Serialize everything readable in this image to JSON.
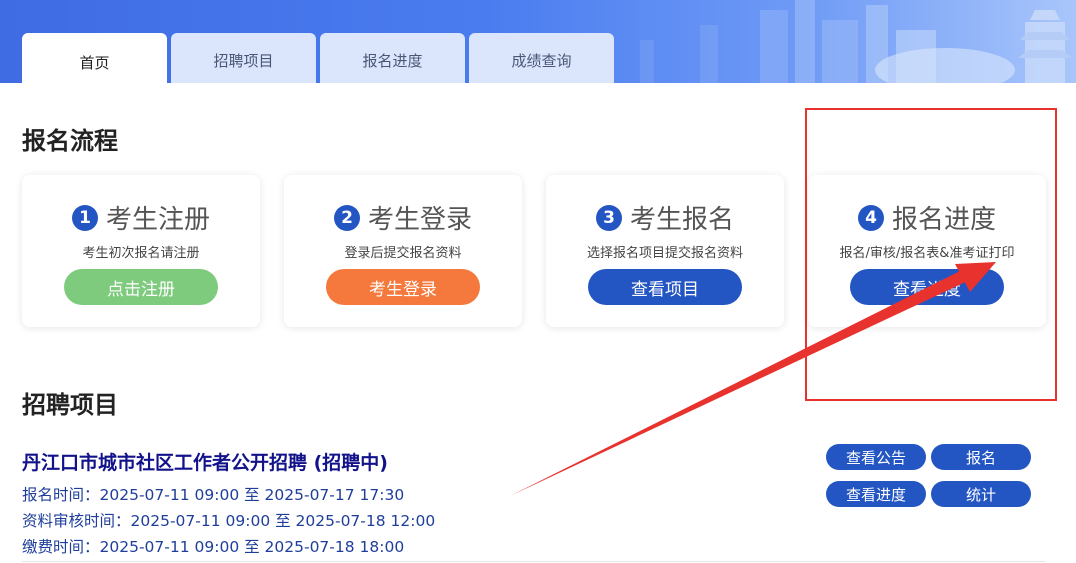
{
  "tabs": [
    {
      "label": "首页",
      "active": true
    },
    {
      "label": "招聘项目",
      "active": false
    },
    {
      "label": "报名进度",
      "active": false
    },
    {
      "label": "成绩查询",
      "active": false
    }
  ],
  "process": {
    "title": "报名流程",
    "steps": [
      {
        "num": "1",
        "title": "考生注册",
        "desc": "考生初次报名请注册",
        "button": "点击注册"
      },
      {
        "num": "2",
        "title": "考生登录",
        "desc": "登录后提交报名资料",
        "button": "考生登录"
      },
      {
        "num": "3",
        "title": "考生报名",
        "desc": "选择报名项目提交报名资料",
        "button": "查看项目"
      },
      {
        "num": "4",
        "title": "报名进度",
        "desc": "报名/审核/报名表&准考证打印",
        "button": "查看进度"
      }
    ]
  },
  "projects": {
    "title": "招聘项目",
    "items": [
      {
        "name": "丹江口市城市社区工作者公开招聘 (招聘中)",
        "signup_time": "报名时间：2025-07-11 09:00 至 2025-07-17 17:30",
        "review_time": "资料审核时间：2025-07-11 09:00 至 2025-07-18 12:00",
        "pay_time": "缴费时间：2025-07-11 09:00 至 2025-07-18 18:00",
        "buttons": {
          "notice": "查看公告",
          "signup": "报名",
          "progress": "查看进度",
          "stats": "统计"
        }
      }
    ]
  },
  "colors": {
    "primary": "#2456c3",
    "green": "#7ecb7e",
    "orange": "#f5793d",
    "annotation": "#e8322e"
  }
}
